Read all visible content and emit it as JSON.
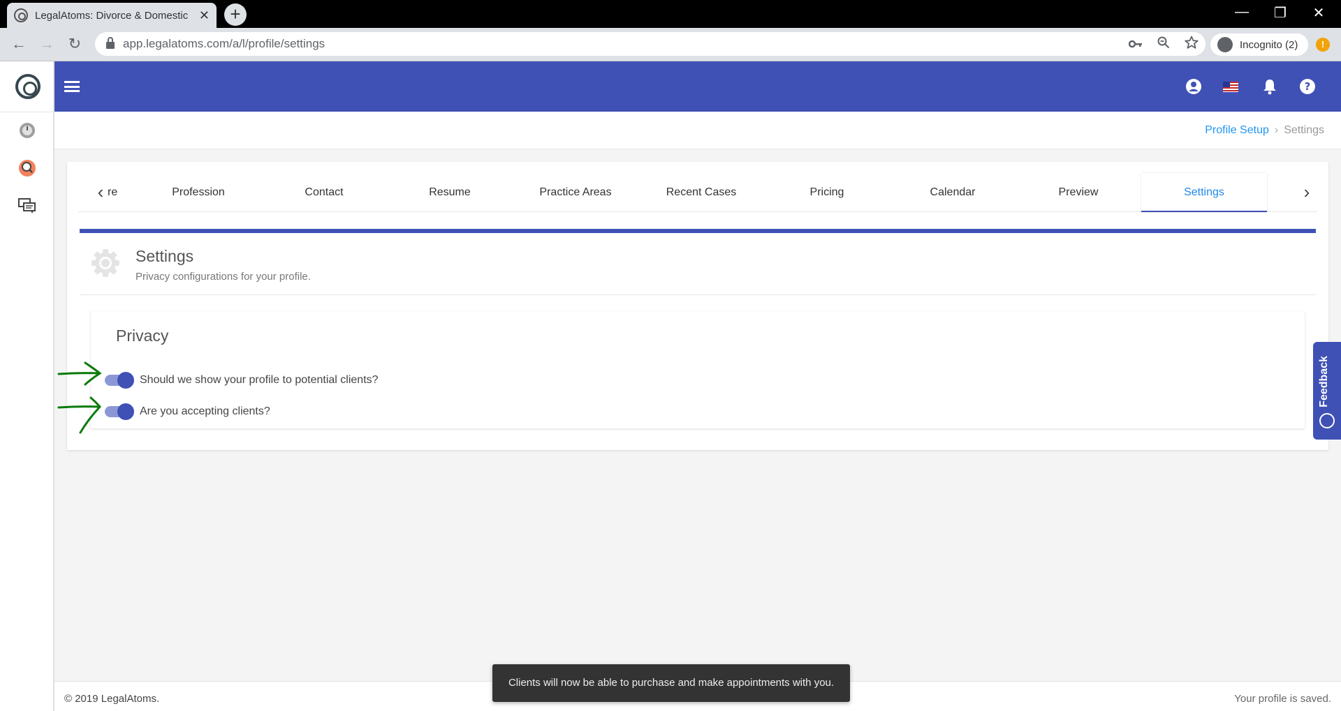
{
  "browser": {
    "tab_title": "LegalAtoms: Divorce & Domestic",
    "tab_close": "✕",
    "new_tab": "+",
    "url": "app.legalatoms.com/a/l/profile/settings",
    "incognito_label": "Incognito (2)",
    "update_badge": "!",
    "win_min": "—",
    "win_restore": "❐",
    "win_close": "✕",
    "back": "←",
    "forward": "→",
    "reload": "↻"
  },
  "icons": {
    "key": "key-icon",
    "zoom": "zoom-icon",
    "star": "star-icon",
    "account": "account-icon",
    "flag": "us-flag-icon",
    "bell": "bell-icon",
    "help": "help-icon"
  },
  "colors": {
    "primary": "#3f51b5",
    "link": "#2196f3",
    "annotation_arrow": "#0a7a0a"
  },
  "breadcrumb": {
    "parent": "Profile Setup",
    "separator": "›",
    "current": "Settings"
  },
  "stepper": {
    "prev": "‹",
    "next": "›",
    "steps": [
      {
        "label": "re"
      },
      {
        "label": "Profession"
      },
      {
        "label": "Contact"
      },
      {
        "label": "Resume"
      },
      {
        "label": "Practice Areas"
      },
      {
        "label": "Recent Cases"
      },
      {
        "label": "Pricing"
      },
      {
        "label": "Calendar"
      },
      {
        "label": "Preview"
      },
      {
        "label": "Settings"
      }
    ],
    "active": "Settings"
  },
  "settings_panel": {
    "title": "Settings",
    "subtitle": "Privacy configurations for your profile."
  },
  "privacy": {
    "title": "Privacy",
    "toggles": [
      {
        "label": "Should we show your profile to potential clients?",
        "on": true
      },
      {
        "label": "Are you accepting clients?",
        "on": true
      }
    ]
  },
  "feedback": {
    "label": "Feedback"
  },
  "footer": {
    "copyright": "© 2019 LegalAtoms.",
    "status": "Your profile is saved."
  },
  "toast": {
    "message": "Clients will now be able to purchase and make appointments with you."
  }
}
